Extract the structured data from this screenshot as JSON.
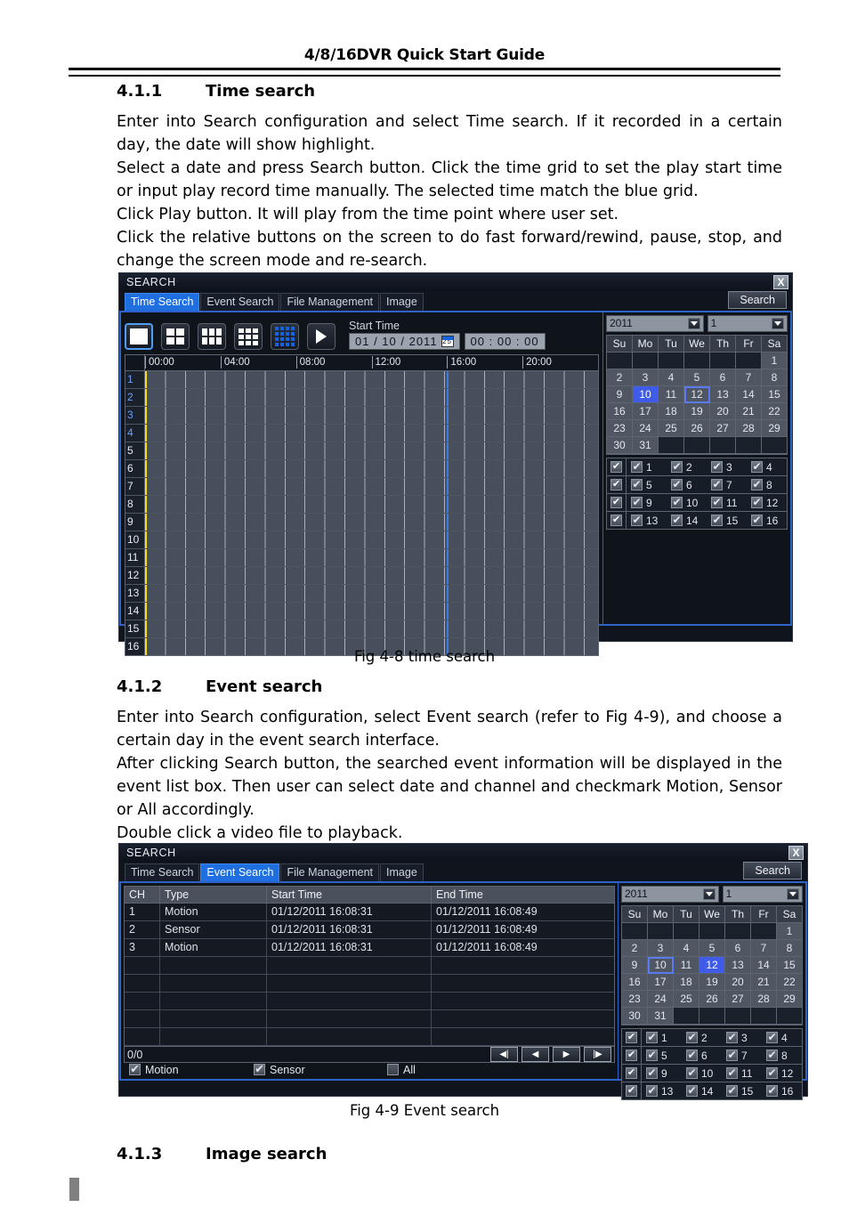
{
  "page": {
    "header_title": "4/8/16DVR Quick Start Guide",
    "side_mark": ""
  },
  "sections": {
    "s411": {
      "number": "4.1.1",
      "title": "Time search",
      "para1": "Enter into Search configuration and select Time search. If it recorded in a certain day, the date will show highlight.",
      "para2_line1": "Select a date and press Search button. Click the time grid to set the play start time or input play record time manually. The selected time match the blue grid.",
      "para2_line2": "Click Play button. It will play from the time point where user set.",
      "para3": "Click the relative buttons on the screen to do fast forward/rewind, pause, stop, and change the screen mode and re-search.",
      "fig_caption": "Fig 4-8 time search"
    },
    "s412": {
      "number": "4.1.2",
      "title": "Event search",
      "para1": "Enter into Search configuration, select Event search (refer to Fig 4-9), and choose a certain day in the event search interface.",
      "para2": "After clicking Search button, the searched event information will be displayed in the event list box. Then user can select date and channel and checkmark Motion, Sensor or All accordingly.",
      "para3": "Double click a video file to playback.",
      "fig_caption": "Fig 4-9 Event search"
    },
    "s413": {
      "number": "4.1.3",
      "title": "Image search"
    }
  },
  "time_search_dialog": {
    "title": "SEARCH",
    "close_label": "X",
    "search_button": "Search",
    "tabs": [
      {
        "label": "Time Search",
        "active": true
      },
      {
        "label": "Event Search",
        "active": false
      },
      {
        "label": "File Management",
        "active": false
      },
      {
        "label": "Image",
        "active": false
      }
    ],
    "view_modes": [
      {
        "name": "view-mode-1",
        "cells": 1,
        "active": true
      },
      {
        "name": "view-mode-4",
        "cells": 4,
        "active": false
      },
      {
        "name": "view-mode-6",
        "cells": 6,
        "active": false
      },
      {
        "name": "view-mode-9",
        "cells": 9,
        "active": false
      },
      {
        "name": "view-mode-16",
        "cells": 16,
        "active": true
      }
    ],
    "play_button_label": "",
    "start_time": {
      "label": "Start Time",
      "date_value": "01 / 10 / 2011",
      "time_value": "00 : 00 : 00",
      "calendar_icon_text": "25"
    },
    "timeline": {
      "hour_labels": [
        "00:00",
        "04:00",
        "08:00",
        "12:00",
        "16:00",
        "20:00"
      ],
      "channels": [
        "1",
        "2",
        "3",
        "4",
        "5",
        "6",
        "7",
        "8",
        "9",
        "10",
        "11",
        "12",
        "13",
        "14",
        "15",
        "16"
      ],
      "highlight_channels": [
        "1",
        "2",
        "3",
        "4"
      ],
      "marker_yellow_hour": 0,
      "marker_blue_hour": 16
    },
    "calendar": {
      "year": "2011",
      "month": "1",
      "dow": [
        "Su",
        "Mo",
        "Tu",
        "We",
        "Th",
        "Fr",
        "Sa"
      ],
      "weeks": [
        [
          "",
          "",
          "",
          "",
          "",
          "",
          "1"
        ],
        [
          "2",
          "3",
          "4",
          "5",
          "6",
          "7",
          "8"
        ],
        [
          "9",
          "10",
          "11",
          "12",
          "13",
          "14",
          "15"
        ],
        [
          "16",
          "17",
          "18",
          "19",
          "20",
          "21",
          "22"
        ],
        [
          "23",
          "24",
          "25",
          "26",
          "27",
          "28",
          "29"
        ],
        [
          "30",
          "31",
          "",
          "",
          "",
          "",
          ""
        ]
      ],
      "selected_day": "10",
      "recorded_day": "12"
    },
    "channel_rows": [
      {
        "all_checked": true,
        "items": [
          {
            "n": "1",
            "c": true
          },
          {
            "n": "2",
            "c": true
          },
          {
            "n": "3",
            "c": true
          },
          {
            "n": "4",
            "c": true
          }
        ]
      },
      {
        "all_checked": true,
        "items": [
          {
            "n": "5",
            "c": true
          },
          {
            "n": "6",
            "c": true
          },
          {
            "n": "7",
            "c": true
          },
          {
            "n": "8",
            "c": true
          }
        ]
      },
      {
        "all_checked": true,
        "items": [
          {
            "n": "9",
            "c": true
          },
          {
            "n": "10",
            "c": true
          },
          {
            "n": "11",
            "c": true
          },
          {
            "n": "12",
            "c": true
          }
        ]
      },
      {
        "all_checked": true,
        "items": [
          {
            "n": "13",
            "c": true
          },
          {
            "n": "14",
            "c": true
          },
          {
            "n": "15",
            "c": true
          },
          {
            "n": "16",
            "c": true
          }
        ]
      }
    ]
  },
  "event_search_dialog": {
    "title": "SEARCH",
    "close_label": "X",
    "search_button": "Search",
    "tabs": [
      {
        "label": "Time Search",
        "active": false
      },
      {
        "label": "Event Search",
        "active": true
      },
      {
        "label": "File Management",
        "active": false
      },
      {
        "label": "Image",
        "active": false
      }
    ],
    "table": {
      "columns": [
        "CH",
        "Type",
        "Start Time",
        "End Time"
      ],
      "rows": [
        {
          "ch": "1",
          "type": "Motion",
          "start": "01/12/2011 16:08:31",
          "end": "01/12/2011 16:08:49"
        },
        {
          "ch": "2",
          "type": "Sensor",
          "start": "01/12/2011 16:08:31",
          "end": "01/12/2011 16:08:49"
        },
        {
          "ch": "3",
          "type": "Motion",
          "start": "01/12/2011 16:08:31",
          "end": "01/12/2011 16:08:49"
        },
        {
          "ch": "",
          "type": "",
          "start": "",
          "end": ""
        },
        {
          "ch": "",
          "type": "",
          "start": "",
          "end": ""
        },
        {
          "ch": "",
          "type": "",
          "start": "",
          "end": ""
        },
        {
          "ch": "",
          "type": "",
          "start": "",
          "end": ""
        },
        {
          "ch": "",
          "type": "",
          "start": "",
          "end": ""
        }
      ]
    },
    "pager": {
      "count": "0/0",
      "first_label": "◀|",
      "prev_label": "◀",
      "next_label": "▶",
      "last_label": "|▶"
    },
    "filters": [
      {
        "label": "Motion",
        "checked": true
      },
      {
        "label": "Sensor",
        "checked": true
      },
      {
        "label": "All",
        "checked": false
      }
    ],
    "calendar": {
      "year": "2011",
      "month": "1",
      "dow": [
        "Su",
        "Mo",
        "Tu",
        "We",
        "Th",
        "Fr",
        "Sa"
      ],
      "weeks": [
        [
          "",
          "",
          "",
          "",
          "",
          "",
          "1"
        ],
        [
          "2",
          "3",
          "4",
          "5",
          "6",
          "7",
          "8"
        ],
        [
          "9",
          "10",
          "11",
          "12",
          "13",
          "14",
          "15"
        ],
        [
          "16",
          "17",
          "18",
          "19",
          "20",
          "21",
          "22"
        ],
        [
          "23",
          "24",
          "25",
          "26",
          "27",
          "28",
          "29"
        ],
        [
          "30",
          "31",
          "",
          "",
          "",
          "",
          ""
        ]
      ],
      "selected_day": "12",
      "recorded_day": "10"
    },
    "channel_rows": [
      {
        "all_checked": true,
        "items": [
          {
            "n": "1",
            "c": true
          },
          {
            "n": "2",
            "c": true
          },
          {
            "n": "3",
            "c": true
          },
          {
            "n": "4",
            "c": true
          }
        ]
      },
      {
        "all_checked": true,
        "items": [
          {
            "n": "5",
            "c": true
          },
          {
            "n": "6",
            "c": true
          },
          {
            "n": "7",
            "c": true
          },
          {
            "n": "8",
            "c": true
          }
        ]
      },
      {
        "all_checked": true,
        "items": [
          {
            "n": "9",
            "c": true
          },
          {
            "n": "10",
            "c": true
          },
          {
            "n": "11",
            "c": true
          },
          {
            "n": "12",
            "c": true
          }
        ]
      },
      {
        "all_checked": true,
        "items": [
          {
            "n": "13",
            "c": true
          },
          {
            "n": "14",
            "c": true
          },
          {
            "n": "15",
            "c": true
          },
          {
            "n": "16",
            "c": true
          }
        ]
      }
    ]
  },
  "colors": {
    "accent_blue": "#1f6fe0",
    "selected_day": "#3f5ce8",
    "marker_yellow": "#f2e208",
    "marker_blue": "#3c7ae6",
    "dialog_bg": "#10141c"
  }
}
